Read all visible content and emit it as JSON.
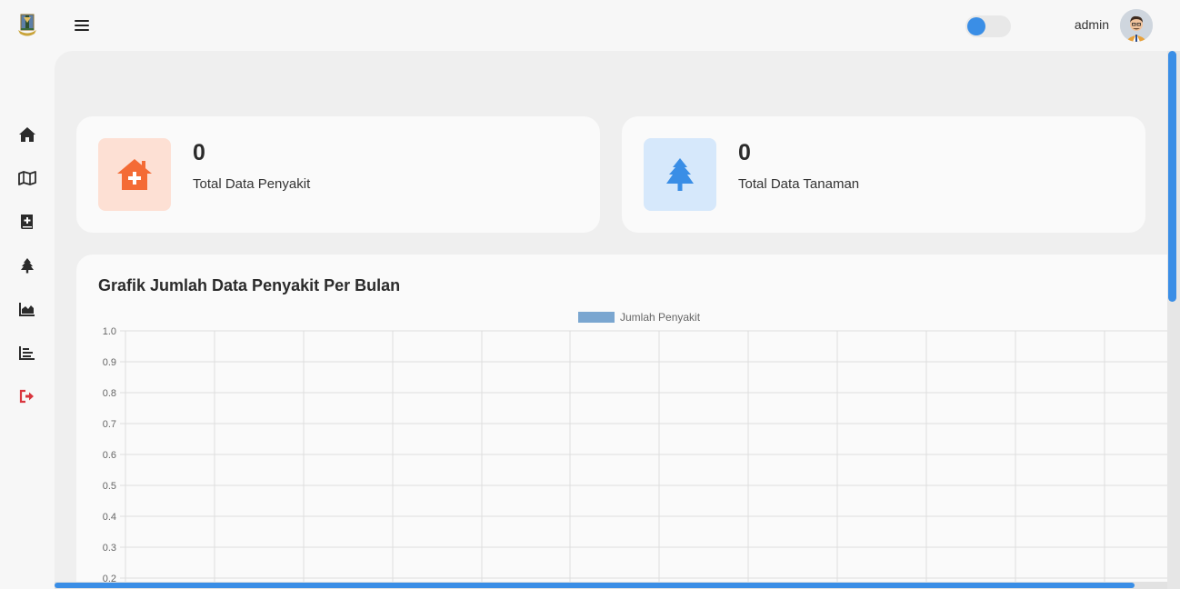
{
  "header": {
    "username": "admin",
    "theme_toggle_state": "on"
  },
  "sidebar": {
    "items": [
      {
        "name": "home",
        "icon": "home-icon"
      },
      {
        "name": "map",
        "icon": "map-icon"
      },
      {
        "name": "medical-book",
        "icon": "medical-book-icon"
      },
      {
        "name": "tree",
        "icon": "tree-icon"
      },
      {
        "name": "area-chart",
        "icon": "area-chart-icon"
      },
      {
        "name": "bar-chart",
        "icon": "bar-chart-icon"
      },
      {
        "name": "logout",
        "icon": "logout-icon",
        "color": "#d9363e"
      }
    ]
  },
  "stats": [
    {
      "count": "0",
      "label": "Total Data Penyakit",
      "icon": "house-medical-icon",
      "icon_color": "#f46b35",
      "bg_color": "#fde0d4"
    },
    {
      "count": "0",
      "label": "Total Data Tanaman",
      "icon": "tree-icon",
      "icon_color": "#3a8ee6",
      "bg_color": "#d6e8fb"
    }
  ],
  "chart": {
    "title": "Grafik Jumlah Data Penyakit Per Bulan"
  },
  "chart_data": {
    "type": "bar",
    "title": "",
    "series": [
      {
        "name": "Jumlah Penyakit",
        "values": [],
        "color": "#7aa6d0"
      }
    ],
    "categories": [],
    "ylim": [
      0,
      1
    ],
    "y_ticks_visible": [
      "1.0",
      "0.9",
      "0.8",
      "0.7",
      "0.6",
      "0.5",
      "0.4",
      "0.3",
      "0.2"
    ],
    "grid": true,
    "legend": "top-center"
  }
}
